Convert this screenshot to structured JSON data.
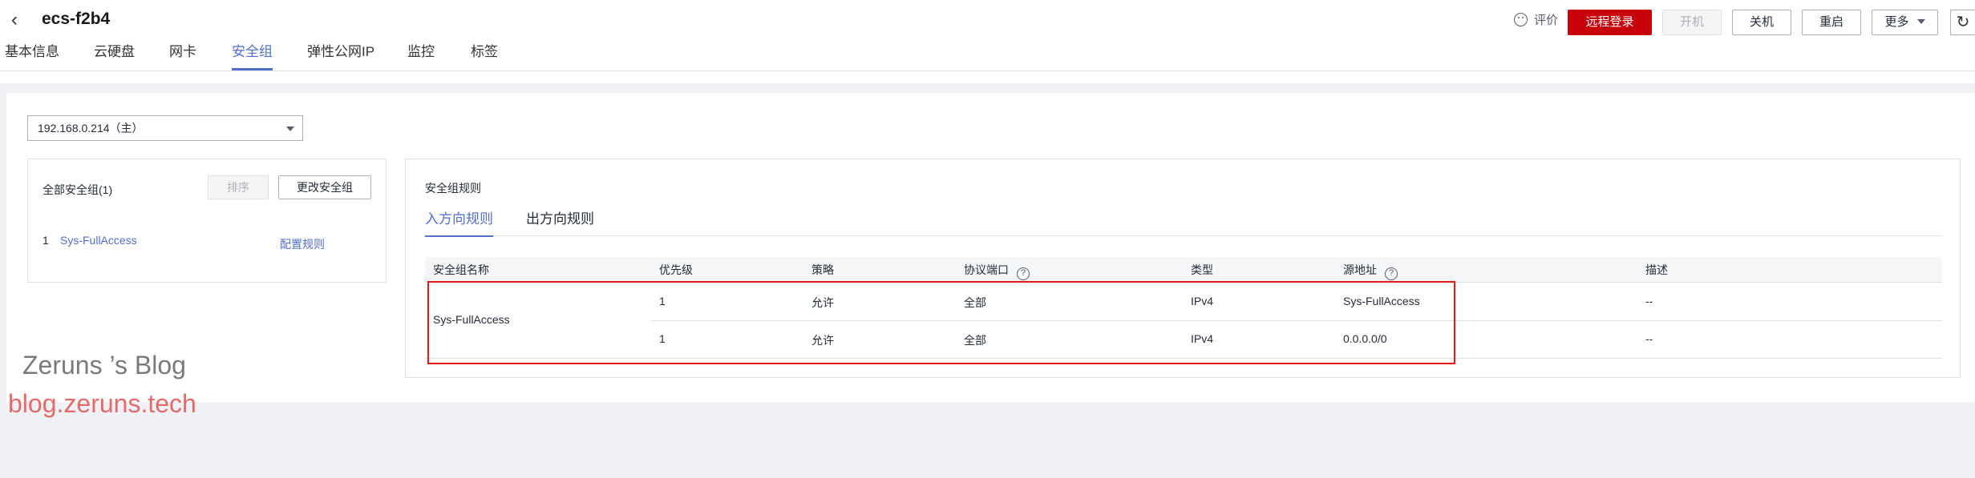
{
  "header": {
    "back_icon": "chevron-left-icon",
    "title": "ecs-f2b4",
    "rate_icon": "smile-icon",
    "rate_label": "评价",
    "buttons": {
      "remote_login": "远程登录",
      "power_on": "开机",
      "power_off": "关机",
      "restart": "重启",
      "more": "更多"
    },
    "refresh_icon": "refresh-icon"
  },
  "tabs": [
    "基本信息",
    "云硬盘",
    "网卡",
    "安全组",
    "弹性公网IP",
    "监控",
    "标签"
  ],
  "active_tab": "安全组",
  "nic_select": {
    "value": "192.168.0.214（主）"
  },
  "security_groups": {
    "title": "全部安全组(1)",
    "sort_label": "排序",
    "change_label": "更改安全组",
    "items": [
      {
        "index": "1",
        "name": "Sys-FullAccess",
        "config_label": "配置规则"
      }
    ]
  },
  "rules": {
    "title": "安全组规则",
    "direction_tabs": [
      "入方向规则",
      "出方向规则"
    ],
    "active_direction": "入方向规则",
    "columns": [
      "安全组名称",
      "优先级",
      "策略",
      "协议端口",
      "类型",
      "源地址",
      "描述"
    ],
    "help_icon": "question-circle-icon",
    "group_name": "Sys-FullAccess",
    "rows": [
      {
        "priority": "1",
        "policy": "允许",
        "port": "全部",
        "type": "IPv4",
        "source": "Sys-FullAccess",
        "desc": "--"
      },
      {
        "priority": "1",
        "policy": "允许",
        "port": "全部",
        "type": "IPv4",
        "source": "0.0.0.0/0",
        "desc": "--"
      }
    ]
  },
  "watermark": {
    "line1": "Zeruns ’s Blog",
    "line2": "blog.zeruns.tech"
  },
  "colors": {
    "accent": "#526ecc",
    "primary_button": "#c7000b",
    "highlight_box": "#e5191a",
    "page_bg": "#f0f1f5"
  }
}
